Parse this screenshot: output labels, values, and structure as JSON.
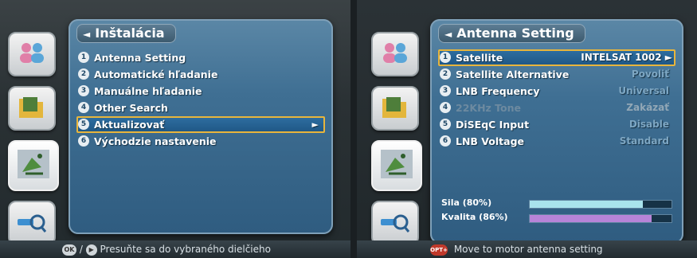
{
  "left_screen": {
    "title": "Inštalácia",
    "items": [
      {
        "num": "1",
        "label": "Antenna Setting"
      },
      {
        "num": "2",
        "label": "Automatické hľadanie"
      },
      {
        "num": "3",
        "label": "Manuálne hľadanie"
      },
      {
        "num": "4",
        "label": "Other Search"
      },
      {
        "num": "5",
        "label": "Aktualizovať"
      },
      {
        "num": "6",
        "label": "Východzie nastavenie"
      }
    ],
    "selected_index": 4,
    "footer": {
      "ok_label": "OK",
      "separator": "/",
      "text": "Presuňte sa do vybraného dielčieho"
    }
  },
  "right_screen": {
    "title": "Antenna Setting",
    "items": [
      {
        "num": "1",
        "label": "Satellite",
        "value": "INTELSAT 1002"
      },
      {
        "num": "2",
        "label": "Satellite Alternative",
        "value": "Povoliť"
      },
      {
        "num": "3",
        "label": "LNB Frequency",
        "value": "Universal"
      },
      {
        "num": "4",
        "label": "22KHz Tone",
        "value": "Zakázať"
      },
      {
        "num": "5",
        "label": "DiSEqC Input",
        "value": "Disable"
      },
      {
        "num": "6",
        "label": "LNB Voltage",
        "value": "Standard"
      }
    ],
    "signal": [
      {
        "label": "Sila (80%)",
        "level": 0.8,
        "color": "#a9e3ec"
      },
      {
        "label": "Kvalita (86%)",
        "level": 0.86,
        "color": "#b784d8"
      }
    ],
    "footer": {
      "opt_label": "OPT+",
      "text": "Move to motor antenna setting"
    }
  },
  "sidebar_icons": [
    "users-icon",
    "folder-icon",
    "satellite-dish-icon",
    "search-icon"
  ],
  "colors": {
    "selection_border": "#e8b53c",
    "panel_blue": "#3f6f93"
  }
}
